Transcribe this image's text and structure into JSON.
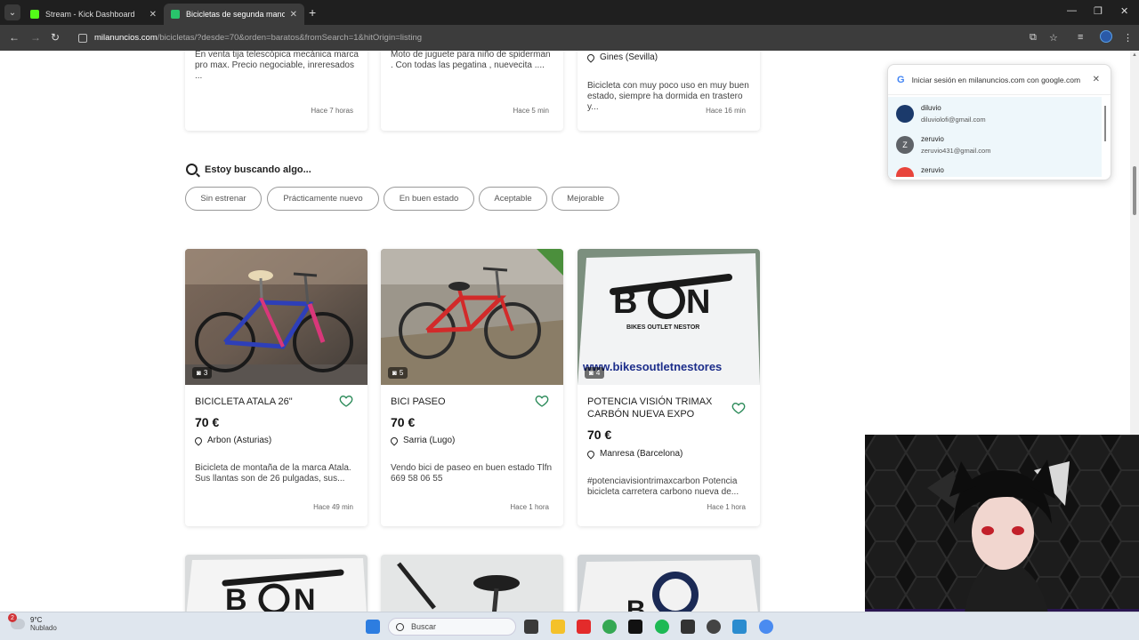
{
  "browser": {
    "tabs": [
      {
        "title": "Stream - Kick Dashboard",
        "favicon_color": "#53fc18",
        "active": false
      },
      {
        "title": "Bicicletas de segunda mano | M",
        "favicon_color": "#29c46b",
        "active": true
      }
    ],
    "url_host": "milanuncios.com",
    "url_path": "/bicicletas/?desde=70&orden=baratos&fromSearch=1&hitOrigin=listing"
  },
  "top_cards": [
    {
      "desc": "En venta tija telescópica mecánica marca pro max. Precio negociable, inreresados ...",
      "time": "Hace 7 horas"
    },
    {
      "desc": "Moto de juguete para niño de spiderman . Con todas las pegatina , nuevecita ....",
      "time": "Hace 5 min"
    },
    {
      "location": "Gines (Sevilla)",
      "desc": "Bicicleta con muy poco uso en muy buen estado, siempre ha dormida en trastero y...",
      "time": "Hace 16 min"
    }
  ],
  "search": {
    "heading": "Estoy buscando algo...",
    "chips": [
      "Sin estrenar",
      "Prácticamente nuevo",
      "En buen estado",
      "Aceptable",
      "Mejorable"
    ]
  },
  "listings": [
    {
      "title": "BICICLETA ATALA 26\"",
      "price": "70 €",
      "location": "Arbon (Asturias)",
      "desc": "Bicicleta de montaña de la marca Atala. Sus llantas son de 26 pulgadas, sus...",
      "time": "Hace 49 min",
      "photos": "3"
    },
    {
      "title": "BICI PASEO",
      "price": "70 €",
      "location": "Sarria (Lugo)",
      "desc": "Vendo bici de paseo en buen estado Tlfn 669 58 06 55",
      "time": "Hace 1 hora",
      "photos": "5"
    },
    {
      "title": "POTENCIA VISIÓN TRIMAX CARBÓN NUEVA EXPO",
      "price": "70 €",
      "location": "Manresa (Barcelona)",
      "desc": "#potenciavisiontrimaxcarbon Potencia bicicleta carretera carbono nueva de...",
      "time": "Hace 1 hora",
      "photos": "4",
      "brand_text": "BIKES OUTLET NESTOR",
      "brand_url": "www.bikesoutletnestores"
    }
  ],
  "google_popup": {
    "title": "Iniciar sesión en milanuncios.com con google.com",
    "accounts": [
      {
        "name": "diluvio",
        "email": "diluviolofi@gmail.com",
        "color": "#1b3a6b",
        "initial": ""
      },
      {
        "name": "zeruvio",
        "email": "zeruvio431@gmail.com",
        "color": "#5f6368",
        "initial": "Z"
      },
      {
        "name": "zeruvio",
        "email": "",
        "color": "#e8453c",
        "initial": ""
      }
    ]
  },
  "taskbar": {
    "weather_temp": "9°C",
    "weather_desc": "Nublado",
    "notif_count": "2",
    "search_placeholder": "Buscar"
  }
}
